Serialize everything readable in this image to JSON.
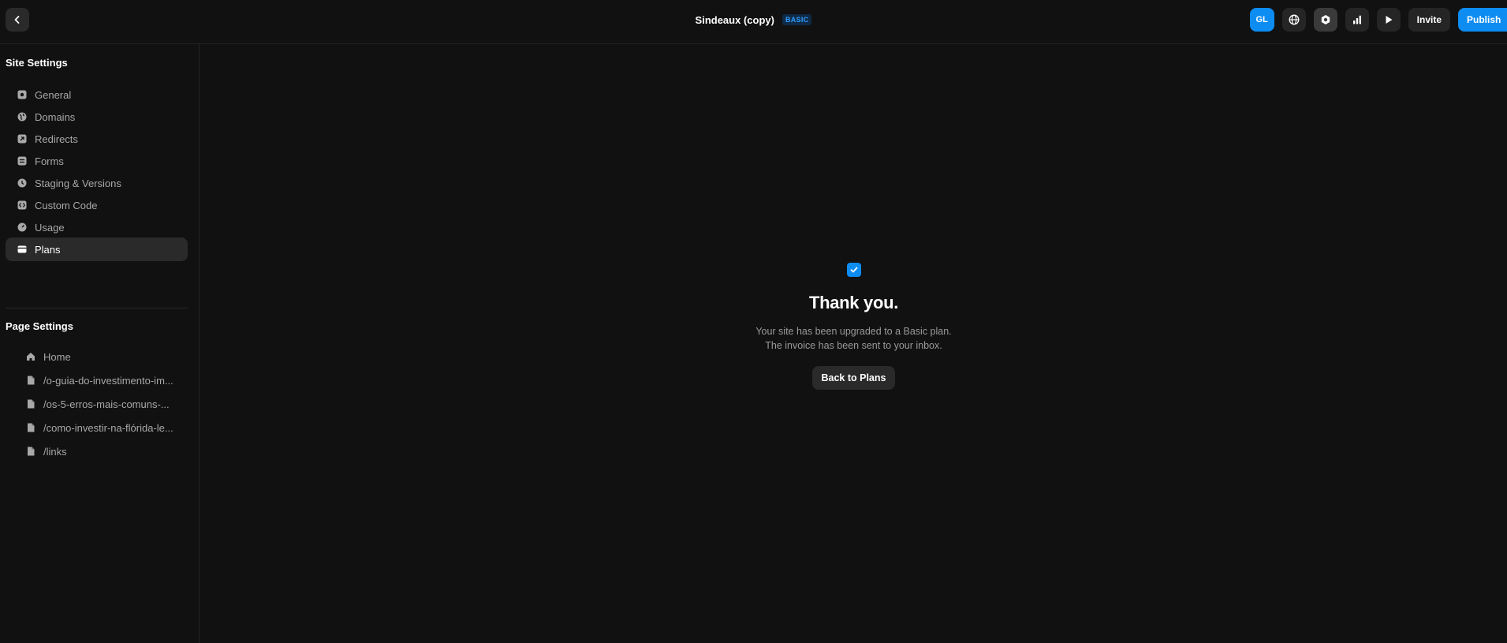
{
  "header": {
    "site_title": "Sindeaux (copy)",
    "plan_badge": "BASIC",
    "avatar_initials": "GL",
    "invite_label": "Invite",
    "publish_label": "Publish"
  },
  "sidebar": {
    "site_settings_title": "Site Settings",
    "site_items": [
      {
        "label": "General",
        "icon": "gear-icon"
      },
      {
        "label": "Domains",
        "icon": "globe-icon"
      },
      {
        "label": "Redirects",
        "icon": "redirect-icon"
      },
      {
        "label": "Forms",
        "icon": "form-icon"
      },
      {
        "label": "Staging & Versions",
        "icon": "clock-icon"
      },
      {
        "label": "Custom Code",
        "icon": "code-icon"
      },
      {
        "label": "Usage",
        "icon": "gauge-icon"
      },
      {
        "label": "Plans",
        "icon": "card-icon"
      }
    ],
    "page_settings_title": "Page Settings",
    "page_items": [
      {
        "label": "Home",
        "icon": "home-icon"
      },
      {
        "label": "/o-guia-do-investimento-im...",
        "icon": "file-icon"
      },
      {
        "label": "/os-5-erros-mais-comuns-...",
        "icon": "file-icon"
      },
      {
        "label": "/como-investir-na-flórida-le...",
        "icon": "file-icon"
      },
      {
        "label": "/links",
        "icon": "file-icon"
      }
    ]
  },
  "main": {
    "heading": "Thank you.",
    "line1": "Your site has been upgraded to a Basic plan.",
    "line2": "The invoice has been sent to your inbox.",
    "back_button": "Back to Plans"
  },
  "colors": {
    "accent": "#0d8cf2",
    "background": "#111111"
  }
}
